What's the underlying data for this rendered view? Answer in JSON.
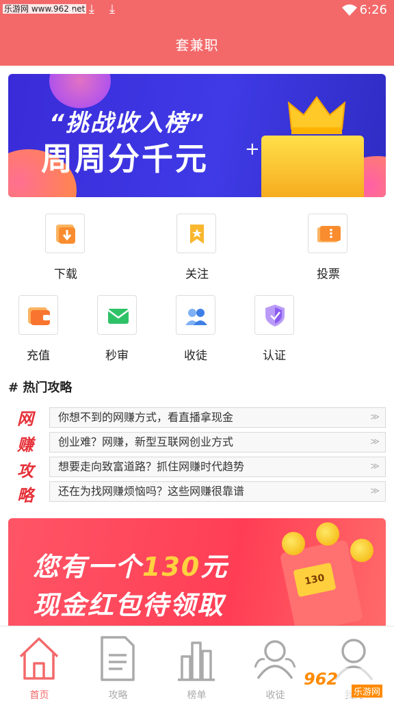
{
  "status_bar": {
    "watermark": "乐游网 www.962.net",
    "time": "6:26"
  },
  "header": {
    "title": "套兼职"
  },
  "banner_top": {
    "line1": "“挑战收入榜”",
    "line2": "周周分千元"
  },
  "features_row1": [
    {
      "label": "下载",
      "icon": "download-icon",
      "color": "#f98c2e"
    },
    {
      "label": "关注",
      "icon": "bookmark-star-icon",
      "color": "#f9b72e"
    },
    {
      "label": "投票",
      "icon": "ticket-icon",
      "color": "#f98c2e"
    }
  ],
  "features_row2": [
    {
      "label": "充值",
      "icon": "wallet-icon",
      "color": "#f9742e"
    },
    {
      "label": "秒审",
      "icon": "mail-icon",
      "color": "#2ec267"
    },
    {
      "label": "收徒",
      "icon": "users-icon",
      "color": "#3e7fe6"
    },
    {
      "label": "认证",
      "icon": "shield-icon",
      "color": "#8a5cf0"
    }
  ],
  "hot_section": {
    "title": "# 热门攻略",
    "side_chars": [
      "网",
      "赚",
      "攻",
      "略"
    ],
    "items": [
      "你想不到的网赚方式，看直播拿现金",
      "创业难？网赚，新型互联网创业方式",
      "想要走向致富道路？抓住网赚时代趋势",
      "还在为找网赚烦恼吗？这些网赚很靠谱"
    ]
  },
  "banner_bottom": {
    "line1_pre": "您有一个",
    "line1_num": "130",
    "line1_post": "元",
    "line2": "现金红包待领取",
    "envelope_label": "130"
  },
  "bottom_nav": [
    {
      "label": "首页",
      "icon": "home-icon",
      "active": true
    },
    {
      "label": "攻略",
      "icon": "document-icon",
      "active": false
    },
    {
      "label": "榜单",
      "icon": "bar-chart-icon",
      "active": false
    },
    {
      "label": "收徒",
      "icon": "group-icon",
      "active": false
    },
    {
      "label": "我的",
      "icon": "user-icon",
      "active": false
    }
  ],
  "watermark_bottom": {
    "big": "962",
    "small": "乐游网"
  },
  "colors": {
    "primary": "#f3696a",
    "accent_red": "#e6323a"
  }
}
